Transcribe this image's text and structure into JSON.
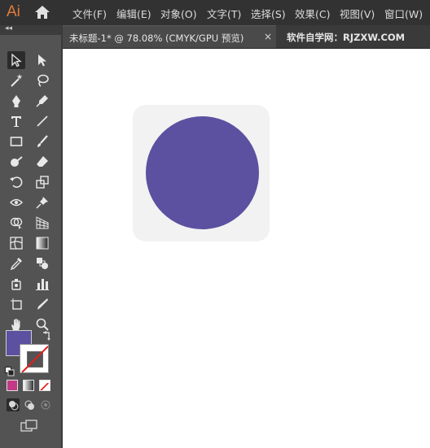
{
  "app": {
    "logo": "Ai"
  },
  "menu": {
    "items": [
      {
        "label": "文件(F)"
      },
      {
        "label": "编辑(E)"
      },
      {
        "label": "对象(O)"
      },
      {
        "label": "文字(T)"
      },
      {
        "label": "选择(S)"
      },
      {
        "label": "效果(C)"
      },
      {
        "label": "视图(V)"
      },
      {
        "label": "窗口(W)"
      }
    ]
  },
  "document": {
    "tab_title": "未标题-1* @ 78.08% (CMYK/GPU 预览)",
    "close_glyph": "×"
  },
  "watermark": "软件自学网：RJZXW.COM",
  "colors": {
    "fill": "#5b51a0",
    "ai_orange": "#e37a3a",
    "artboard_bg": "#f2f2f2",
    "menubar": "#323232",
    "panel": "#535353"
  },
  "tools": [
    "selection-tool",
    "direct-selection-tool",
    "magic-wand-tool",
    "lasso-tool",
    "pen-tool",
    "curvature-tool",
    "type-tool",
    "line-tool",
    "rectangle-tool",
    "paintbrush-tool",
    "shaper-tool",
    "eraser-tool",
    "rotate-tool",
    "scale-tool",
    "width-tool",
    "puppet-warp-tool",
    "shape-builder-tool",
    "perspective-grid-tool",
    "mesh-tool",
    "gradient-tool",
    "eyedropper-tool",
    "blend-tool",
    "symbol-sprayer-tool",
    "column-graph-tool",
    "artboard-tool",
    "slice-tool",
    "hand-tool",
    "zoom-tool"
  ]
}
